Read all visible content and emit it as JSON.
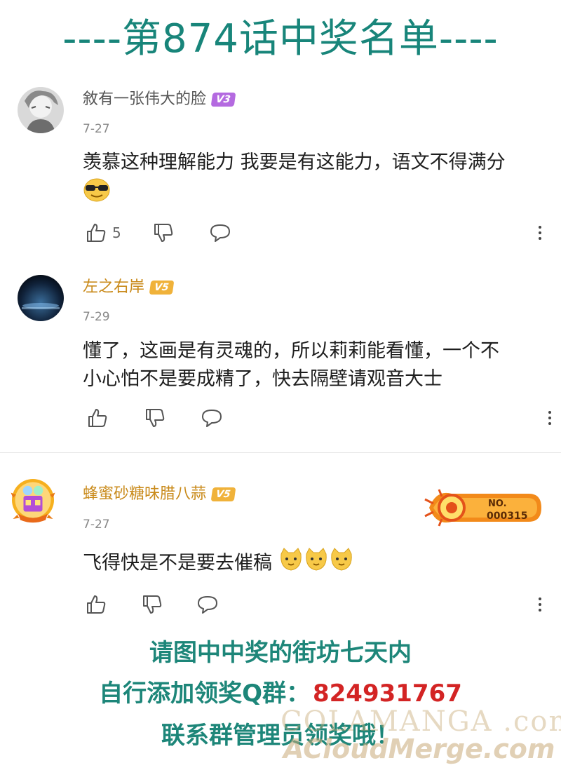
{
  "page_title": "----第874话中奖名单----",
  "comments": [
    {
      "username": "敘有一张伟大的脸",
      "username_color": "#555555",
      "badge": "V3",
      "badge_color": "#b46ae0",
      "date": "7-27",
      "text": "羡慕这种理解能力 我要是有这能力，语文不得满分",
      "emojis": [
        "sunglasses-emoji"
      ],
      "like_count": "5"
    },
    {
      "username": "左之右岸",
      "username_color": "#c98a1a",
      "badge": "V5",
      "badge_color": "#f0b23a",
      "date": "7-29",
      "text_lines": [
        "懂了，这画是有灵魂的，所以莉莉能看懂，一个不",
        "小心怕不是要成精了，快去隔壁请观音大士"
      ],
      "like_count": ""
    },
    {
      "username": "蜂蜜砂糖味腊八蒜",
      "username_color": "#c98a1a",
      "badge": "V5",
      "badge_color": "#f0b23a",
      "date": "7-27",
      "text": "飞得快是不是要去催稿",
      "emojis": [
        "cat-emoji",
        "cat-emoji",
        "cat-emoji"
      ],
      "like_count": "",
      "medal": {
        "label_top": "NO.",
        "label_number": "000315"
      }
    }
  ],
  "footer": {
    "line1": "请图中中奖的街坊七天内",
    "line2_prefix": "自行添加领奖Q群：",
    "line2_qq": "824931767",
    "line3": "联系群管理员领奖哦！"
  },
  "watermark": {
    "line1": "COLAMANGA .com",
    "line2": "ACloudMerge.com"
  },
  "colors": {
    "title": "#18857a",
    "footer": "#1d8679",
    "qq_number": "#d32424"
  }
}
